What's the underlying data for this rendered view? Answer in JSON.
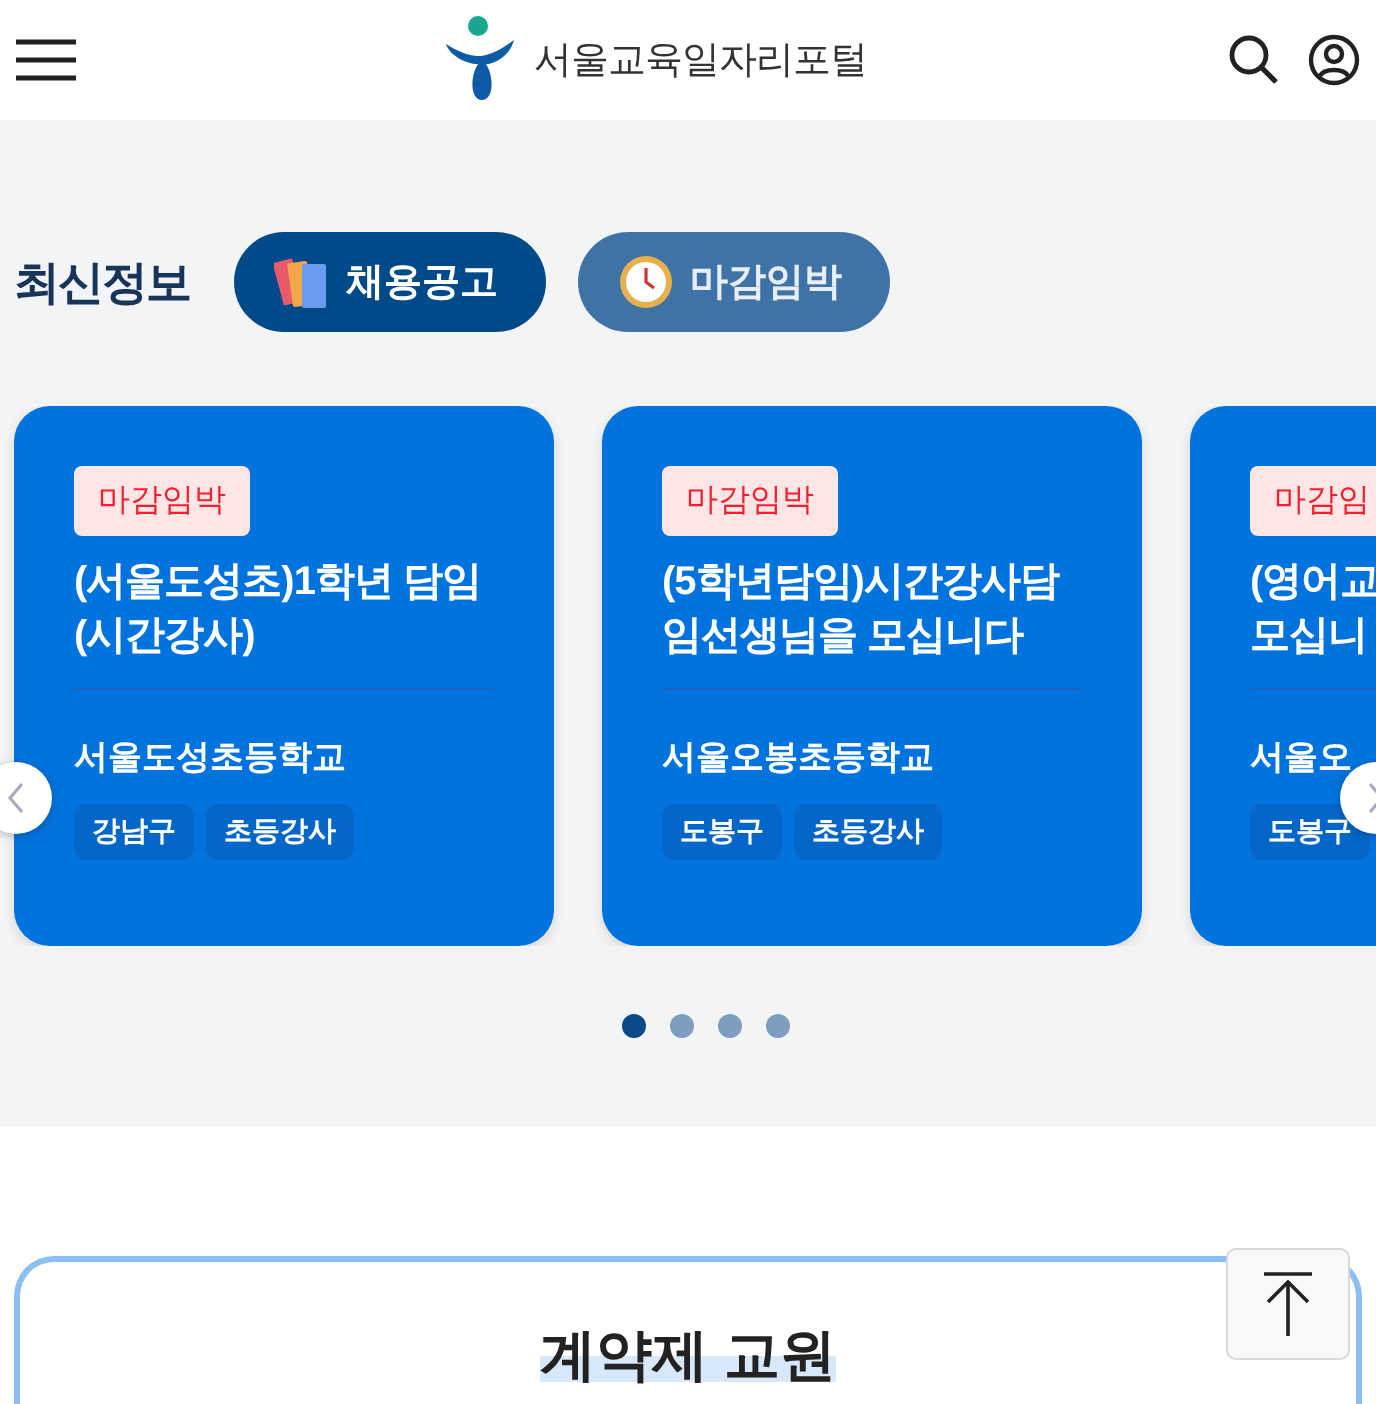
{
  "header": {
    "logo_text": "서울교육일자리포털"
  },
  "latest": {
    "title": "최신정보",
    "tabs": [
      {
        "label": "채용공고",
        "kind": "books",
        "selected": true
      },
      {
        "label": "마감임박",
        "kind": "clock",
        "selected": false
      }
    ],
    "cards": [
      {
        "badge": "마감임박",
        "title": "(서울도성초)1학년 담임 (시간강사)",
        "school": "서울도성초등학교",
        "tags": [
          "강남구",
          "초등강사"
        ]
      },
      {
        "badge": "마감임박",
        "title": "(5학년담임)시간강사담임선생님을 모십니다",
        "school": "서울오봉초등학교",
        "tags": [
          "도봉구",
          "초등강사"
        ]
      },
      {
        "badge": "마감임",
        "title_lines": [
          "(영어교",
          "모십니"
        ],
        "school": "서울오",
        "tags": [
          "도봉구"
        ]
      }
    ],
    "dots": [
      {
        "selected": true
      },
      {
        "selected": false
      },
      {
        "selected": false
      },
      {
        "selected": false
      }
    ]
  },
  "section": {
    "title": "계약제 교원"
  }
}
